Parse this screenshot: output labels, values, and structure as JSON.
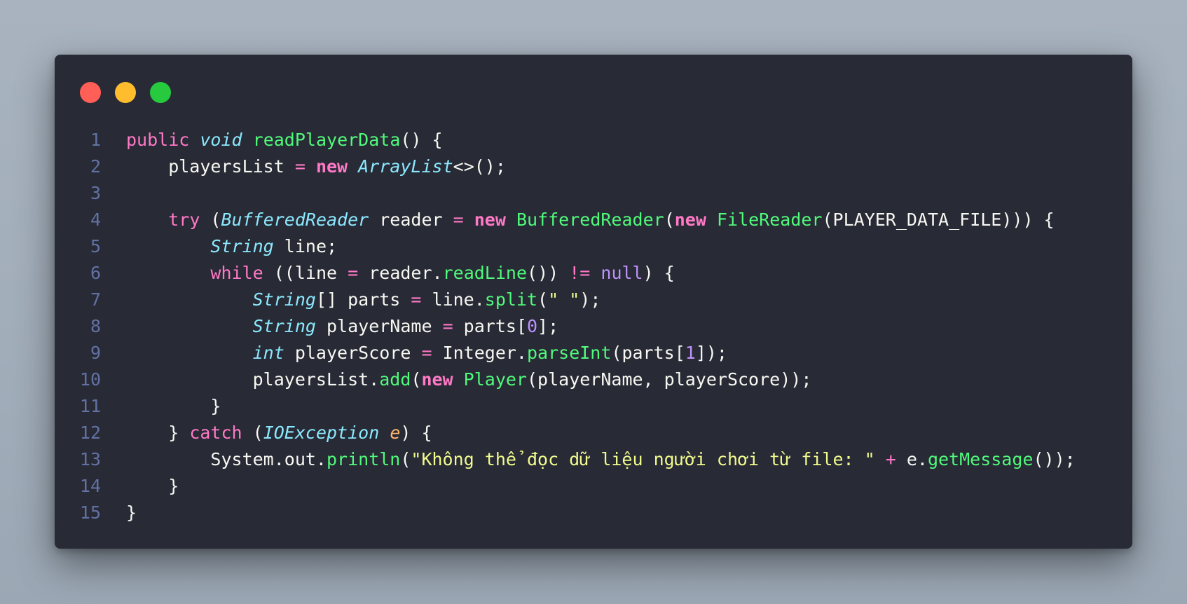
{
  "window": {
    "controls": [
      {
        "name": "close-button",
        "color": "#ff5f56"
      },
      {
        "name": "minimize-button",
        "color": "#ffbd2e"
      },
      {
        "name": "maximize-button",
        "color": "#27c93f"
      }
    ]
  },
  "code": {
    "lines": [
      {
        "n": "1",
        "tokens": [
          {
            "t": "public",
            "c": "kw"
          },
          {
            "t": " ",
            "c": "pl"
          },
          {
            "t": "void",
            "c": "ty"
          },
          {
            "t": " ",
            "c": "pl"
          },
          {
            "t": "readPlayerData",
            "c": "fn"
          },
          {
            "t": "() {",
            "c": "pl"
          }
        ]
      },
      {
        "n": "2",
        "tokens": [
          {
            "t": "    playersList ",
            "c": "pl"
          },
          {
            "t": "=",
            "c": "op"
          },
          {
            "t": " ",
            "c": "pl"
          },
          {
            "t": "new",
            "c": "kwb"
          },
          {
            "t": " ",
            "c": "pl"
          },
          {
            "t": "ArrayList",
            "c": "ty"
          },
          {
            "t": "<>();",
            "c": "pl"
          }
        ]
      },
      {
        "n": "3",
        "tokens": []
      },
      {
        "n": "4",
        "tokens": [
          {
            "t": "    ",
            "c": "pl"
          },
          {
            "t": "try",
            "c": "kw"
          },
          {
            "t": " (",
            "c": "pl"
          },
          {
            "t": "BufferedReader",
            "c": "ty"
          },
          {
            "t": " reader ",
            "c": "pl"
          },
          {
            "t": "=",
            "c": "op"
          },
          {
            "t": " ",
            "c": "pl"
          },
          {
            "t": "new",
            "c": "kwb"
          },
          {
            "t": " ",
            "c": "pl"
          },
          {
            "t": "BufferedReader",
            "c": "fn"
          },
          {
            "t": "(",
            "c": "pl"
          },
          {
            "t": "new",
            "c": "kwb"
          },
          {
            "t": " ",
            "c": "pl"
          },
          {
            "t": "FileReader",
            "c": "fn"
          },
          {
            "t": "(PLAYER_DATA_FILE))) {",
            "c": "pl"
          }
        ]
      },
      {
        "n": "5",
        "tokens": [
          {
            "t": "        ",
            "c": "pl"
          },
          {
            "t": "String",
            "c": "ty"
          },
          {
            "t": " line;",
            "c": "pl"
          }
        ]
      },
      {
        "n": "6",
        "tokens": [
          {
            "t": "        ",
            "c": "pl"
          },
          {
            "t": "while",
            "c": "kw"
          },
          {
            "t": " ((line ",
            "c": "pl"
          },
          {
            "t": "=",
            "c": "op"
          },
          {
            "t": " reader.",
            "c": "pl"
          },
          {
            "t": "readLine",
            "c": "fn"
          },
          {
            "t": "()) ",
            "c": "pl"
          },
          {
            "t": "!=",
            "c": "op"
          },
          {
            "t": " ",
            "c": "pl"
          },
          {
            "t": "null",
            "c": "nu"
          },
          {
            "t": ") {",
            "c": "pl"
          }
        ]
      },
      {
        "n": "7",
        "tokens": [
          {
            "t": "            ",
            "c": "pl"
          },
          {
            "t": "String",
            "c": "ty"
          },
          {
            "t": "[] parts ",
            "c": "pl"
          },
          {
            "t": "=",
            "c": "op"
          },
          {
            "t": " line.",
            "c": "pl"
          },
          {
            "t": "split",
            "c": "fn"
          },
          {
            "t": "(",
            "c": "pl"
          },
          {
            "t": "\" \"",
            "c": "st"
          },
          {
            "t": ");",
            "c": "pl"
          }
        ]
      },
      {
        "n": "8",
        "tokens": [
          {
            "t": "            ",
            "c": "pl"
          },
          {
            "t": "String",
            "c": "ty"
          },
          {
            "t": " playerName ",
            "c": "pl"
          },
          {
            "t": "=",
            "c": "op"
          },
          {
            "t": " parts[",
            "c": "pl"
          },
          {
            "t": "0",
            "c": "nu"
          },
          {
            "t": "];",
            "c": "pl"
          }
        ]
      },
      {
        "n": "9",
        "tokens": [
          {
            "t": "            ",
            "c": "pl"
          },
          {
            "t": "int",
            "c": "ty"
          },
          {
            "t": " playerScore ",
            "c": "pl"
          },
          {
            "t": "=",
            "c": "op"
          },
          {
            "t": " Integer.",
            "c": "pl"
          },
          {
            "t": "parseInt",
            "c": "fn"
          },
          {
            "t": "(parts[",
            "c": "pl"
          },
          {
            "t": "1",
            "c": "nu"
          },
          {
            "t": "]);",
            "c": "pl"
          }
        ]
      },
      {
        "n": "10",
        "tokens": [
          {
            "t": "            playersList.",
            "c": "pl"
          },
          {
            "t": "add",
            "c": "fn"
          },
          {
            "t": "(",
            "c": "pl"
          },
          {
            "t": "new",
            "c": "kwb"
          },
          {
            "t": " ",
            "c": "pl"
          },
          {
            "t": "Player",
            "c": "fn"
          },
          {
            "t": "(playerName, playerScore));",
            "c": "pl"
          }
        ]
      },
      {
        "n": "11",
        "tokens": [
          {
            "t": "        }",
            "c": "pl"
          }
        ]
      },
      {
        "n": "12",
        "tokens": [
          {
            "t": "    } ",
            "c": "pl"
          },
          {
            "t": "catch",
            "c": "kw"
          },
          {
            "t": " (",
            "c": "pl"
          },
          {
            "t": "IOException",
            "c": "ty"
          },
          {
            "t": " ",
            "c": "pl"
          },
          {
            "t": "e",
            "c": "pa"
          },
          {
            "t": ") {",
            "c": "pl"
          }
        ]
      },
      {
        "n": "13",
        "tokens": [
          {
            "t": "        System.out.",
            "c": "pl"
          },
          {
            "t": "println",
            "c": "fn"
          },
          {
            "t": "(",
            "c": "pl"
          },
          {
            "t": "\"Không thể đọc dữ liệu người chơi từ file: \"",
            "c": "st"
          },
          {
            "t": " ",
            "c": "pl"
          },
          {
            "t": "+",
            "c": "op"
          },
          {
            "t": " e.",
            "c": "pl"
          },
          {
            "t": "getMessage",
            "c": "fn"
          },
          {
            "t": "());",
            "c": "pl"
          }
        ]
      },
      {
        "n": "14",
        "tokens": [
          {
            "t": "    }",
            "c": "pl"
          }
        ]
      },
      {
        "n": "15",
        "tokens": [
          {
            "t": "}",
            "c": "pl"
          }
        ]
      }
    ]
  },
  "colors": {
    "background": "#282a36",
    "line_numbers": "#6272a4",
    "keyword": "#ff79c6",
    "type": "#8be9fd",
    "function": "#50fa7b",
    "string": "#f1fa8c",
    "number": "#bd93f9",
    "parameter": "#ffb86c",
    "text": "#f8f8f2"
  }
}
